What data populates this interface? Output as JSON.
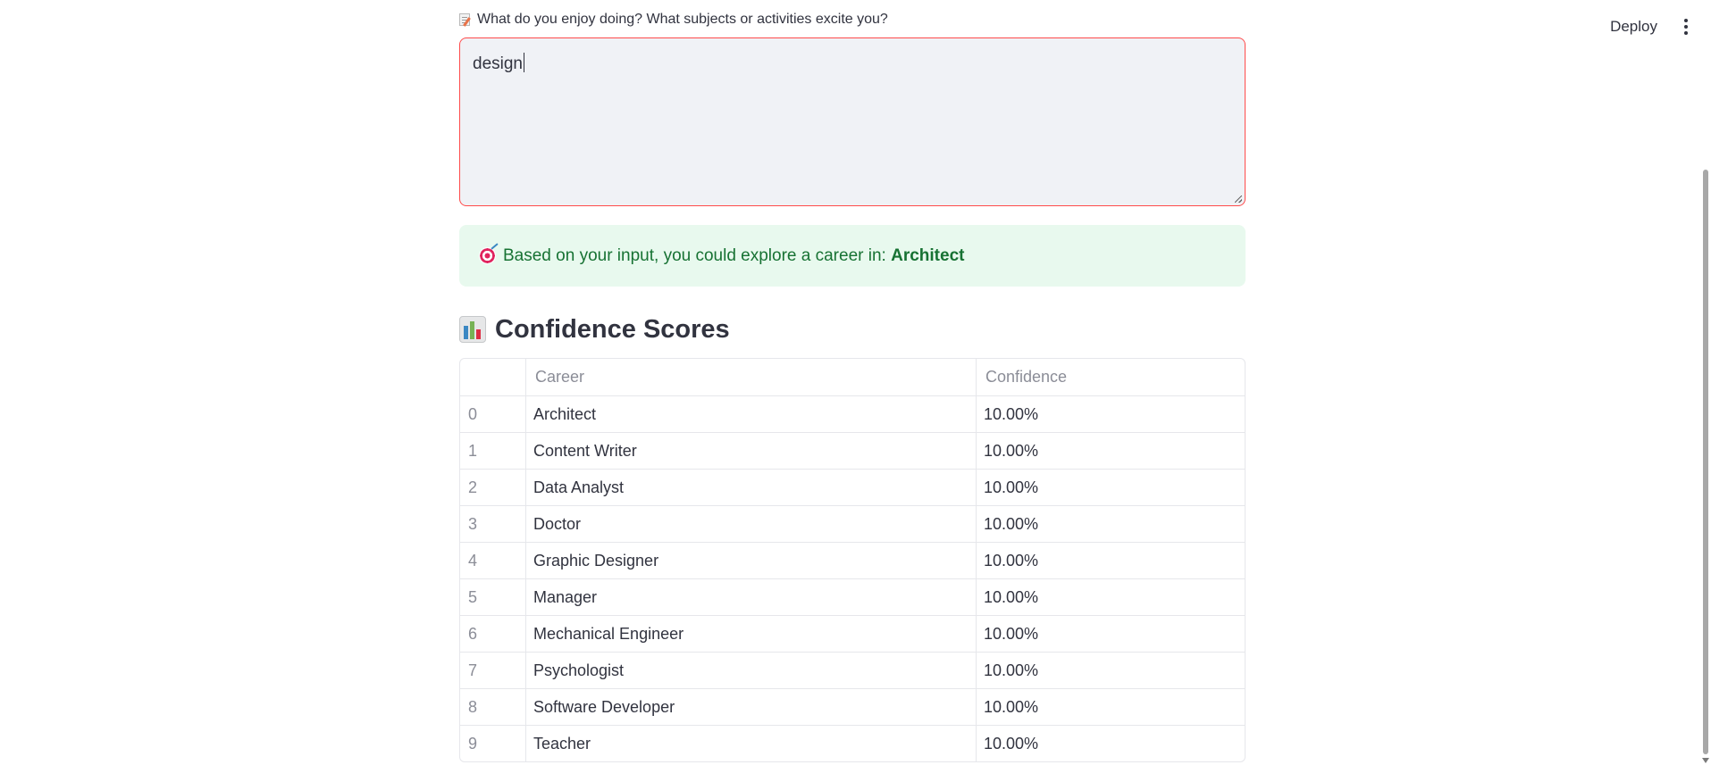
{
  "header": {
    "deploy_label": "Deploy",
    "menu_icon": "kebab-menu-icon"
  },
  "question": {
    "icon": "memo-icon",
    "label": "What do you enjoy doing? What subjects or activities excite you?",
    "value": "design"
  },
  "result": {
    "icon": "target-icon",
    "prefix": "Based on your input, you could explore a career in:",
    "career": "Architect"
  },
  "section": {
    "icon": "bar-chart-icon",
    "title": "Confidence Scores"
  },
  "table": {
    "columns": [
      "",
      "Career",
      "Confidence"
    ],
    "rows": [
      {
        "index": "0",
        "career": "Architect",
        "confidence": "10.00%"
      },
      {
        "index": "1",
        "career": "Content Writer",
        "confidence": "10.00%"
      },
      {
        "index": "2",
        "career": "Data Analyst",
        "confidence": "10.00%"
      },
      {
        "index": "3",
        "career": "Doctor",
        "confidence": "10.00%"
      },
      {
        "index": "4",
        "career": "Graphic Designer",
        "confidence": "10.00%"
      },
      {
        "index": "5",
        "career": "Manager",
        "confidence": "10.00%"
      },
      {
        "index": "6",
        "career": "Mechanical Engineer",
        "confidence": "10.00%"
      },
      {
        "index": "7",
        "career": "Psychologist",
        "confidence": "10.00%"
      },
      {
        "index": "8",
        "career": "Software Developer",
        "confidence": "10.00%"
      },
      {
        "index": "9",
        "career": "Teacher",
        "confidence": "10.00%"
      }
    ]
  },
  "colors": {
    "accent_border": "#ff4b4b",
    "success_bg": "#e8f9ee",
    "success_text": "#177233",
    "text": "#31333f",
    "muted": "#8b8d97"
  }
}
